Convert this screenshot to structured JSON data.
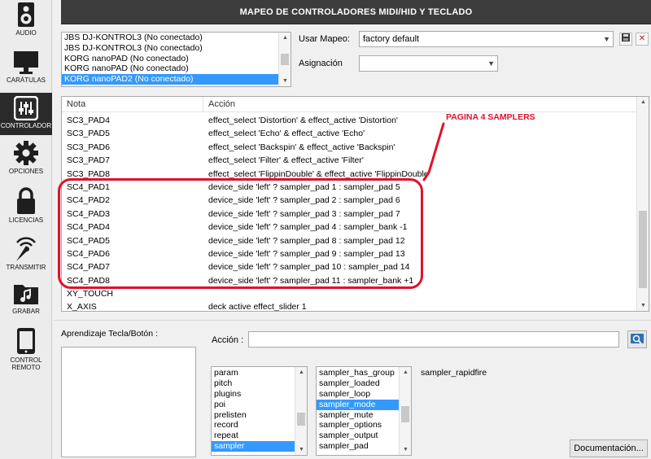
{
  "header": {
    "title": "MAPEO DE CONTROLADORES MIDI/HID Y TECLADO"
  },
  "sidebar": {
    "items": [
      {
        "label": "AUDIO",
        "icon": "speaker-icon"
      },
      {
        "label": "CARÁTULAS",
        "icon": "monitor-icon"
      },
      {
        "label": "CONTROLADOR",
        "icon": "sliders-icon",
        "active": true
      },
      {
        "label": "OPCIONES",
        "icon": "gear-icon"
      },
      {
        "label": "LICENCIAS",
        "icon": "lock-icon"
      },
      {
        "label": "TRANSMITIR",
        "icon": "broadcast-icon"
      },
      {
        "label": "GRABAR",
        "icon": "music-folder-icon"
      },
      {
        "label": "CONTROL REMOTO",
        "icon": "tablet-icon"
      }
    ]
  },
  "controllers": {
    "items": [
      "JBS DJ-KONTROL3 (No conectado)",
      "JBS DJ-KONTROL3 (No conectado)",
      "KORG nanoPAD (No conectado)",
      "KORG nanoPAD (No conectado)",
      "KORG nanoPAD2 (No conectado)"
    ],
    "selected_index": 4
  },
  "mapping": {
    "usar_label": "Usar Mapeo:",
    "usar_value": "factory default",
    "asignacion_label": "Asignación",
    "asignacion_value": ""
  },
  "table": {
    "col_nota": "Nota",
    "col_accion": "Acción",
    "rows": [
      {
        "nota": "SC3_PAD4",
        "accion": "effect_select 'Distortion' & effect_active 'Distortion'"
      },
      {
        "nota": "SC3_PAD5",
        "accion": "effect_select 'Echo' & effect_active 'Echo'"
      },
      {
        "nota": "SC3_PAD6",
        "accion": "effect_select 'Backspin' & effect_active 'Backspin'"
      },
      {
        "nota": "SC3_PAD7",
        "accion": "effect_select 'Filter' & effect_active 'Filter'"
      },
      {
        "nota": "SC3_PAD8",
        "accion": "effect_select 'FlippinDouble' & effect_active 'FlippinDouble'"
      },
      {
        "nota": "SC4_PAD1",
        "accion": "device_side 'left' ? sampler_pad 1 : sampler_pad 5"
      },
      {
        "nota": "SC4_PAD2",
        "accion": "device_side 'left' ? sampler_pad 2 : sampler_pad 6"
      },
      {
        "nota": "SC4_PAD3",
        "accion": "device_side 'left' ? sampler_pad 3 : sampler_pad 7"
      },
      {
        "nota": "SC4_PAD4",
        "accion": "device_side 'left' ? sampler_pad 4 : sampler_bank -1"
      },
      {
        "nota": "SC4_PAD5",
        "accion": "device_side 'left' ? sampler_pad 8 : sampler_pad 12"
      },
      {
        "nota": "SC4_PAD6",
        "accion": "device_side 'left' ? sampler_pad 9 : sampler_pad 13"
      },
      {
        "nota": "SC4_PAD7",
        "accion": "device_side 'left' ? sampler_pad 10 : sampler_pad 14"
      },
      {
        "nota": "SC4_PAD8",
        "accion": "device_side 'left' ? sampler_pad 11 : sampler_bank +1"
      },
      {
        "nota": "XY_TOUCH",
        "accion": ""
      },
      {
        "nota": "X_AXIS",
        "accion": "deck active effect_slider 1"
      }
    ]
  },
  "annotation": {
    "text": "PAGINA 4 SAMPLERS",
    "color": "#e0112b"
  },
  "learn": {
    "label": "Aprendizaje Tecla/Botón :"
  },
  "action": {
    "label": "Acción :",
    "value": ""
  },
  "verbs": {
    "items": [
      "param",
      "pitch",
      "plugins",
      "poi",
      "prelisten",
      "record",
      "repeat",
      "sampler"
    ],
    "selected_index": 7
  },
  "subverbs": {
    "items": [
      "sampler_has_group",
      "sampler_loaded",
      "sampler_loop",
      "sampler_mode",
      "sampler_mute",
      "sampler_options",
      "sampler_output",
      "sampler_pad"
    ],
    "selected_index": 3
  },
  "verb_help": "sampler_rapidfire",
  "doc_button": "Documentación..."
}
